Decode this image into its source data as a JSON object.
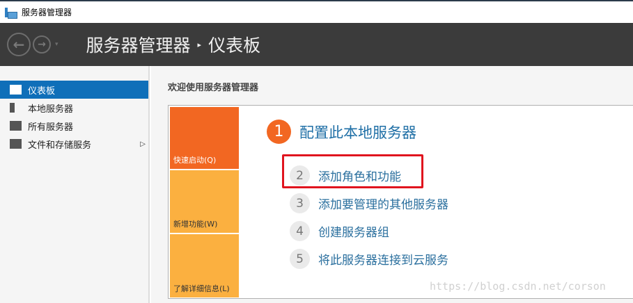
{
  "window": {
    "title": "服务器管理器"
  },
  "header": {
    "breadcrumb_root": "服务器管理器",
    "separator": "▸",
    "current": "仪表板",
    "back": "←",
    "forward": "→",
    "dropdown": "▾"
  },
  "sidebar": {
    "items": [
      {
        "label": "仪表板",
        "active": true
      },
      {
        "label": "本地服务器"
      },
      {
        "label": "所有服务器"
      },
      {
        "label": "文件和存储服务",
        "expand": "▷"
      }
    ]
  },
  "main": {
    "welcome": "欢迎使用服务器管理器",
    "tiles": [
      "快速启动(Q)",
      "新增功能(W)",
      "了解详细信息(L)"
    ],
    "step1": {
      "num": "1",
      "label": "配置此本地服务器"
    },
    "steps": [
      {
        "num": "2",
        "label": "添加角色和功能"
      },
      {
        "num": "3",
        "label": "添加要管理的其他服务器"
      },
      {
        "num": "4",
        "label": "创建服务器组"
      },
      {
        "num": "5",
        "label": "将此服务器连接到云服务"
      }
    ]
  },
  "watermark": "https://blog.csdn.net/corson",
  "colors": {
    "accent": "#0f6fb9",
    "orange": "#f26722",
    "amber": "#fbb040",
    "highlight": "#e0141e"
  }
}
